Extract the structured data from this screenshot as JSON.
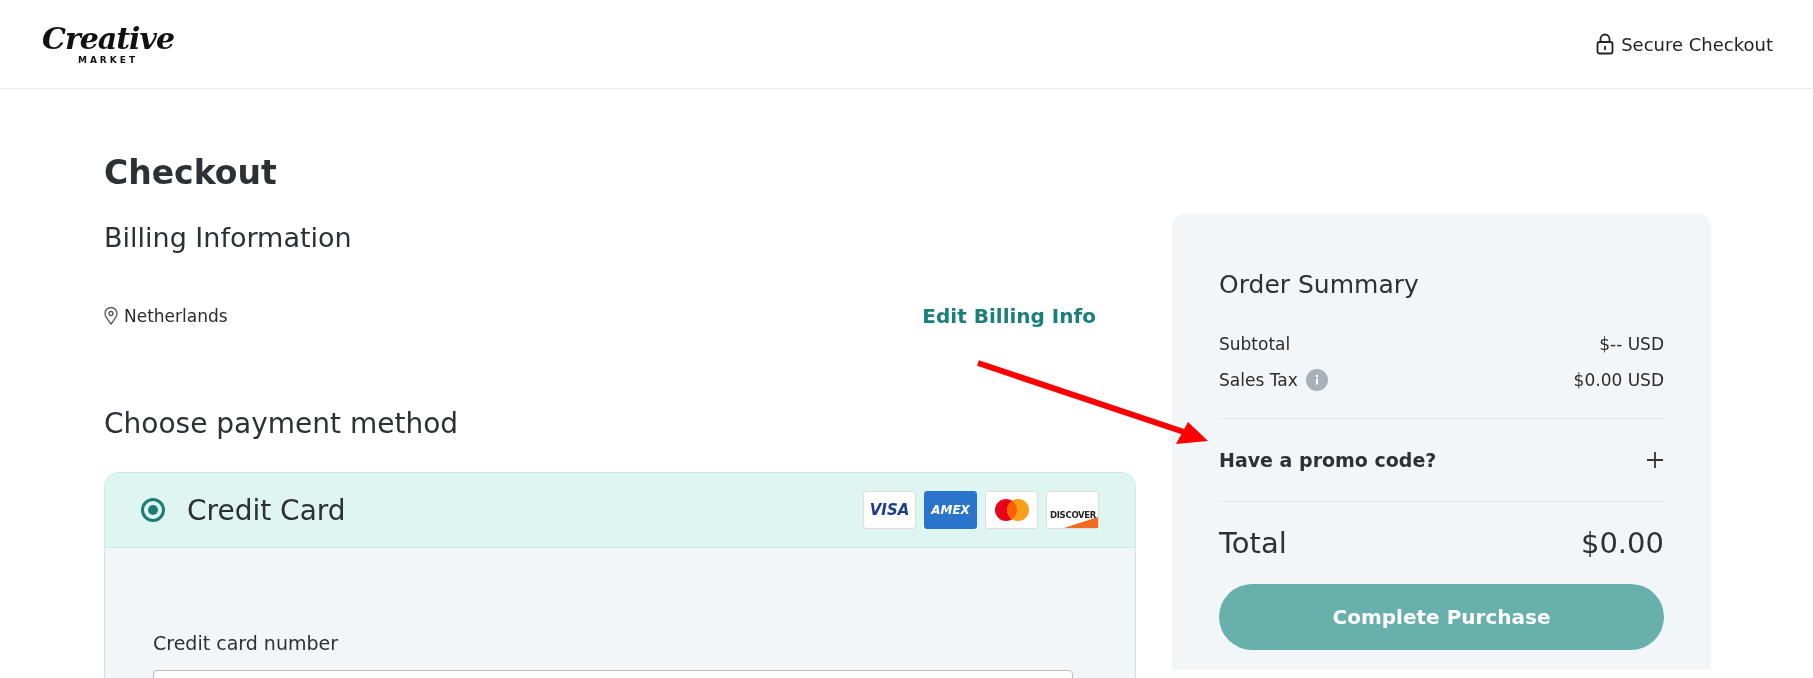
{
  "header": {
    "logo": {
      "script": "Creative",
      "caps": "MARKET"
    },
    "secure_label": "Secure Checkout"
  },
  "checkout": {
    "title": "Checkout",
    "billing_title": "Billing Information",
    "country": "Netherlands",
    "edit_link": "Edit Billing Info",
    "payment_title": "Choose payment method",
    "payment_methods": [
      {
        "label": "Credit Card",
        "selected": true,
        "cards": [
          {
            "kind": "visa",
            "text": "VISA"
          },
          {
            "kind": "amex",
            "text": "AMEX"
          },
          {
            "kind": "mastercard"
          },
          {
            "kind": "discover",
            "text": "DISCOVER"
          }
        ],
        "fields": [
          {
            "label": "Credit card number"
          }
        ]
      }
    ]
  },
  "order_summary": {
    "title": "Order Summary",
    "lines": [
      {
        "label": "Subtotal",
        "value": "$-- USD",
        "info": false
      },
      {
        "label": "Sales Tax",
        "value": "$0.00 USD",
        "info": true
      }
    ],
    "promo": {
      "label": "Have a promo code?",
      "expanded": false
    },
    "total_label": "Total",
    "total_value": "$0.00",
    "button": "Complete Purchase"
  }
}
